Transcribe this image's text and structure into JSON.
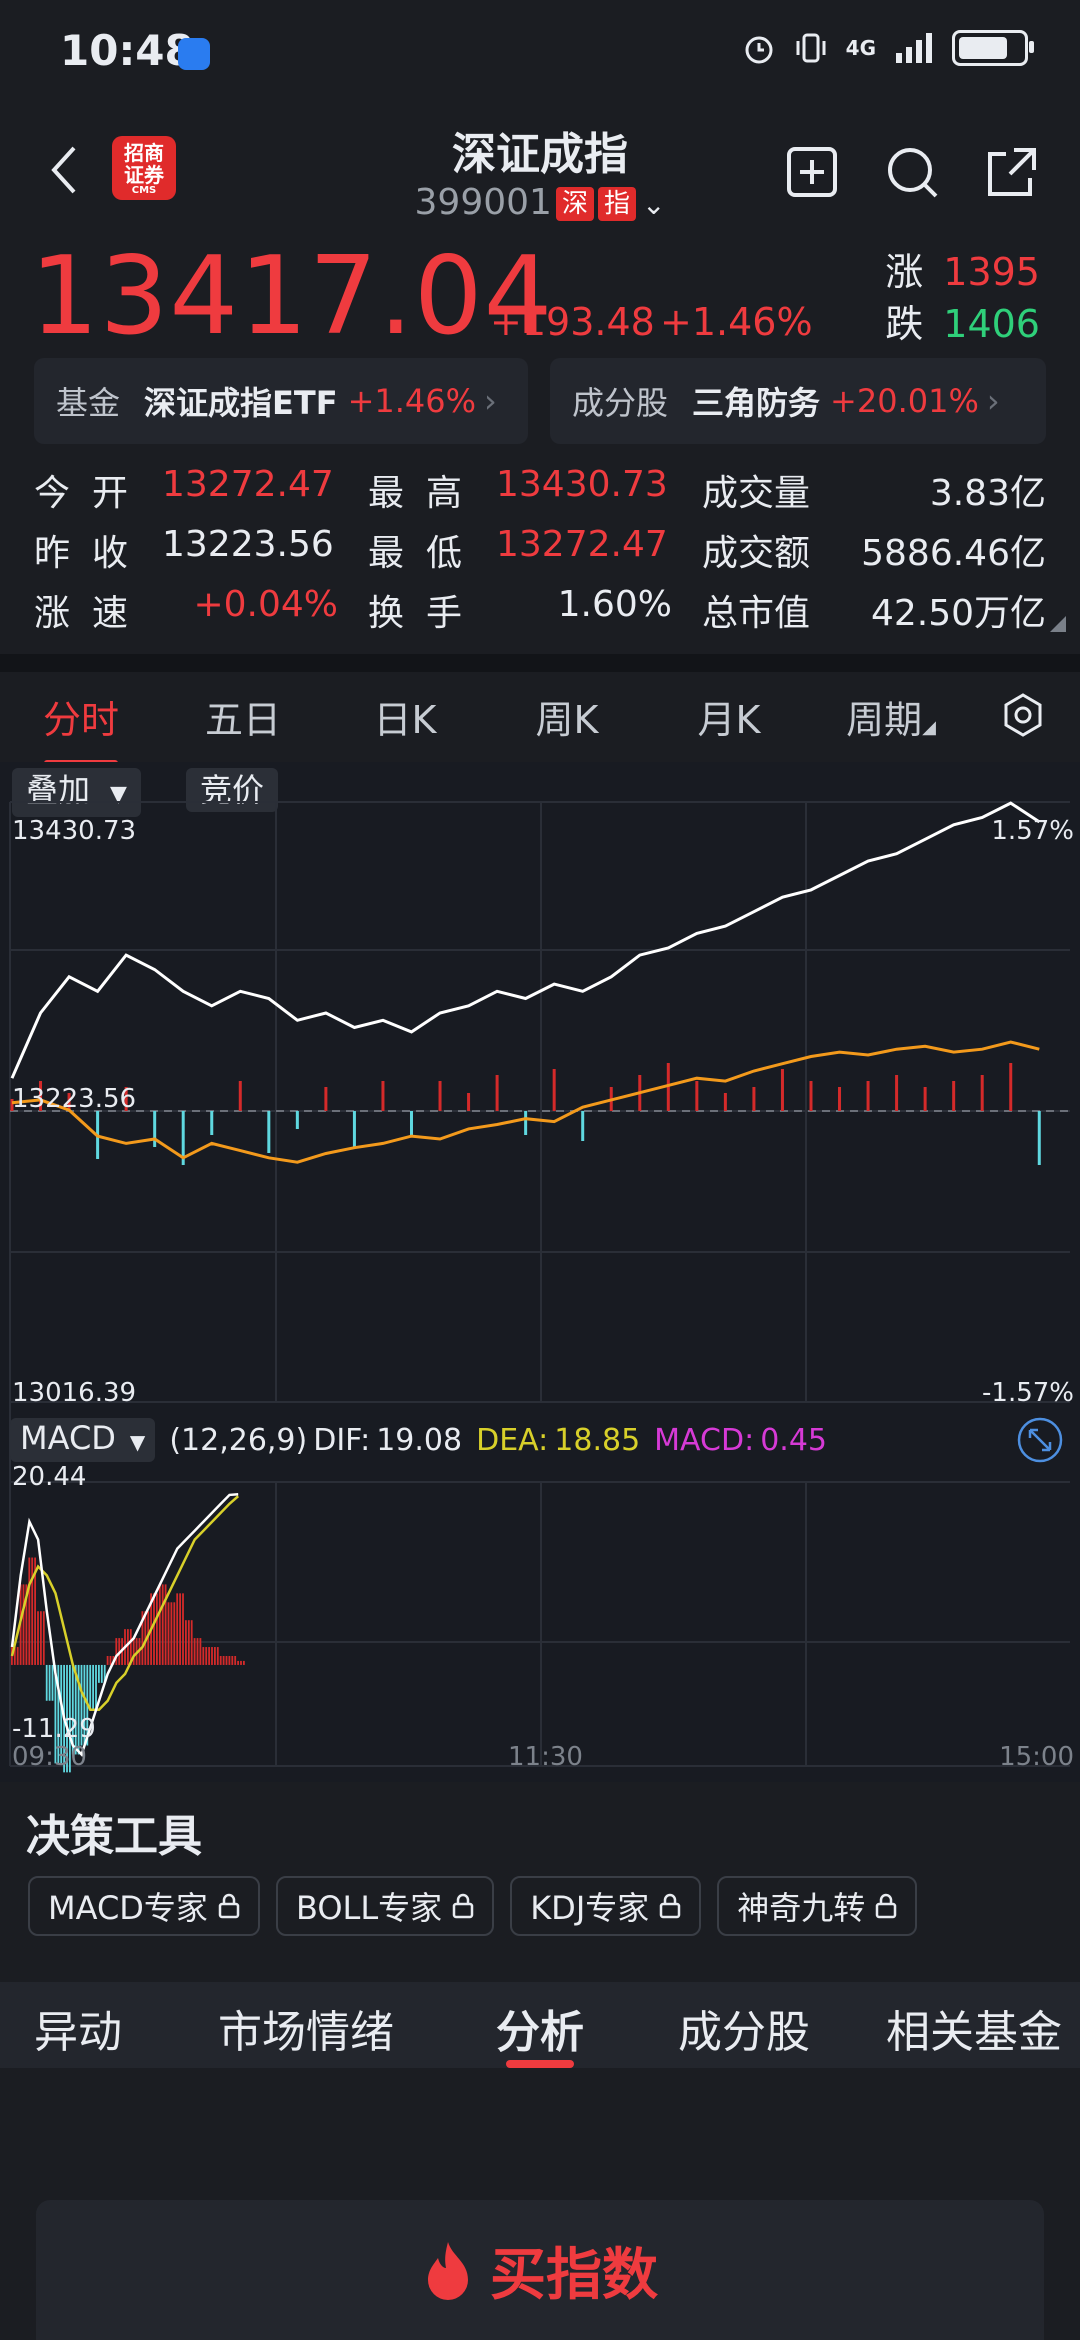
{
  "status_bar": {
    "time": "10:48",
    "network": "4G",
    "battery_level": 0.85
  },
  "header": {
    "title": "深证成指",
    "code": "399001",
    "market_tag_1": "深",
    "market_tag_2": "指",
    "logo_line_1": "招商",
    "logo_line_2": "证券",
    "logo_sub": "CMS"
  },
  "quote": {
    "last_price": "13417.04",
    "change_abs": "+193.48",
    "change_pct": "+1.46%",
    "up_label": "涨",
    "up_count": "1395",
    "down_label": "跌",
    "down_count": "1406"
  },
  "fund_card": {
    "label": "基金",
    "name": "深证成指ETF",
    "pct": "+1.46%"
  },
  "component_card": {
    "label": "成分股",
    "name": "三角防务",
    "pct": "+20.01%"
  },
  "stats": [
    [
      {
        "label": "今开",
        "value": "13272.47",
        "color": "red"
      },
      {
        "label": "最高",
        "value": "13430.73",
        "color": "red"
      },
      {
        "label": "成交量",
        "value": "3.83亿",
        "color": "white"
      }
    ],
    [
      {
        "label": "昨收",
        "value": "13223.56",
        "color": "white"
      },
      {
        "label": "最低",
        "value": "13272.47",
        "color": "red"
      },
      {
        "label": "成交额",
        "value": "5886.46亿",
        "color": "white"
      }
    ],
    [
      {
        "label": "涨速",
        "value": "+0.04%",
        "color": "red"
      },
      {
        "label": "换手",
        "value": "1.60%",
        "color": "white"
      },
      {
        "label": "总市值",
        "value": "42.50万亿",
        "color": "white"
      }
    ]
  ],
  "chart_tabs": [
    "分时",
    "五日",
    "日K",
    "周K",
    "月K",
    "周期"
  ],
  "chart_tab_active": 0,
  "chart_toolbar": {
    "overlay": "叠加",
    "auction": "竞价"
  },
  "chart_labels": {
    "high": "13430.73",
    "high_pct": "1.57%",
    "prev_close": "13223.56",
    "low": "13016.39",
    "low_pct": "-1.57%",
    "macd_high": "20.44",
    "macd_low": "-11.29",
    "time_start": "09:30",
    "time_mid": "11:30",
    "time_end": "15:00"
  },
  "macd": {
    "selector": "MACD",
    "params": "(12,26,9)",
    "dif_label": "DIF:",
    "dif": "19.08",
    "dea_label": "DEA:",
    "dea": "18.85",
    "macd_label": "MACD:",
    "macd": "0.45"
  },
  "chart_data": {
    "type": "line",
    "ylim": [
      13016.39,
      13430.73
    ],
    "prev_close": 13223.56,
    "price": [
      13240,
      13285,
      13310,
      13300,
      13325,
      13315,
      13300,
      13290,
      13300,
      13295,
      13280,
      13285,
      13275,
      13280,
      13272,
      13285,
      13290,
      13300,
      13295,
      13305,
      13300,
      13310,
      13325,
      13330,
      13340,
      13345,
      13355,
      13365,
      13370,
      13380,
      13390,
      13395,
      13405,
      13415,
      13420,
      13430,
      13417
    ],
    "average": [
      13223,
      13225,
      13218,
      13200,
      13195,
      13198,
      13185,
      13195,
      13190,
      13185,
      13182,
      13188,
      13192,
      13195,
      13200,
      13198,
      13205,
      13208,
      13212,
      13210,
      13220,
      13225,
      13230,
      13235,
      13240,
      13238,
      13245,
      13250,
      13255,
      13258,
      13256,
      13260,
      13262,
      13258,
      13260,
      13265,
      13260
    ],
    "volume": [
      0.2,
      0.5,
      0.3,
      0.8,
      0.4,
      0.6,
      0.9,
      0.4,
      0.5,
      0.7,
      0.3,
      0.4,
      0.6,
      0.5,
      0.4,
      0.5,
      0.3,
      0.6,
      0.4,
      0.7,
      0.5,
      0.4,
      0.6,
      0.8,
      0.5,
      0.3,
      0.4,
      0.7,
      0.5,
      0.4,
      0.5,
      0.6,
      0.4,
      0.5,
      0.6,
      0.8,
      0.9
    ],
    "macd_ylim": [
      -11.29,
      20.44
    ],
    "dif": [
      2,
      10,
      16,
      14,
      6,
      -1,
      -6,
      -9,
      -10,
      -7,
      -4,
      -1,
      1,
      2,
      3,
      5,
      7,
      9,
      11,
      13,
      14,
      15,
      16,
      17,
      18,
      19,
      19.08
    ],
    "dea": [
      1,
      5,
      9,
      11,
      10,
      8,
      4,
      0,
      -3,
      -5,
      -5,
      -4,
      -2,
      -1,
      1,
      2,
      4,
      6,
      8,
      10,
      12,
      14,
      15,
      16,
      17,
      18,
      18.85
    ],
    "macd_hist": [
      2,
      9,
      12,
      6,
      -4,
      -11,
      -12,
      -10,
      -9,
      -5,
      -2,
      1,
      3,
      4,
      3,
      6,
      8,
      9,
      7,
      8,
      5,
      3,
      2,
      2,
      1,
      1,
      0.45
    ]
  },
  "tools": {
    "title": "决策工具",
    "items": [
      "MACD专家",
      "BOLL专家",
      "KDJ专家",
      "神奇九转"
    ]
  },
  "bottom_tabs": [
    "异动",
    "市场情绪",
    "分析",
    "成分股",
    "相关基金"
  ],
  "bottom_tab_active": 2,
  "buy_button": "买指数",
  "colors": {
    "up": "#ef3b3f",
    "down": "#2fd07a",
    "price_line": "#ffffff",
    "avg_line": "#f39a1c",
    "vol_up": "#d42a2a",
    "vol_down": "#5fd8e0",
    "dea_line": "#d8d02a"
  }
}
